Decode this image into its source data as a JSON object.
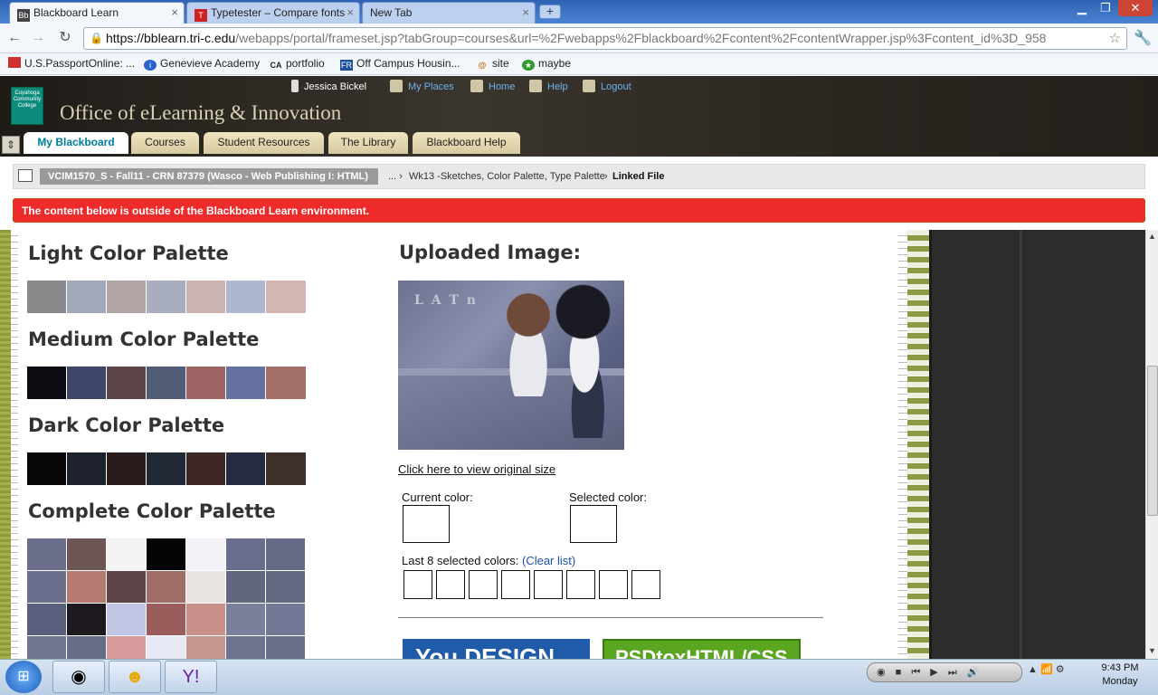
{
  "browser": {
    "tabs": [
      {
        "label": "Blackboard Learn",
        "icon": "Bb"
      },
      {
        "label": "Typetester – Compare fonts",
        "icon": "T"
      },
      {
        "label": "New Tab",
        "icon": ""
      }
    ],
    "new_tab": "+",
    "url_host": "https://bblearn.tri-c.edu",
    "url_path": "/webapps/portal/frameset.jsp?tabGroup=courses&url=%2Fwebapps%2Fblackboard%2Fcontent%2FcontentWrapper.jsp%3Fcontent_id%3D_958",
    "bookmarks": [
      "U.S.PassportOnline: ...",
      "Genevieve Academy",
      "portfolio",
      "Off Campus Housin...",
      "site",
      "maybe"
    ]
  },
  "blackboard": {
    "logo_text": "Cuyahoga Community College",
    "site_title": "Office of eLearning & Innovation",
    "user_name": "Jessica Bickel",
    "utility_links": [
      "My Places",
      "Home",
      "Help",
      "Logout"
    ],
    "tabs": [
      "My Blackboard",
      "Courses",
      "Student Resources",
      "The Library",
      "Blackboard Help"
    ],
    "course_name": "VCIM1570_S - Fall11 - CRN 87379 (Wasco - Web Publishing I: HTML)",
    "breadcrumb_ellipsis": "...",
    "breadcrumb_item": "Wk13 -Sketches, Color Palette, Type Palette",
    "breadcrumb_current": "Linked File",
    "separator": "›",
    "alert": "The content below is outside of the Blackboard Learn environment."
  },
  "palettes": {
    "light_title": "Light Color Palette",
    "light": [
      "#8a8a8c",
      "#a2a7b9",
      "#b3a4a4",
      "#a8aebd",
      "#cdb2b2",
      "#afb6cf",
      "#d3b5b2"
    ],
    "medium_title": "Medium Color Palette",
    "medium": [
      "#0c0c12",
      "#3c4666",
      "#5f4448",
      "#515c77",
      "#9c6462",
      "#65729f",
      "#a46e6a"
    ],
    "dark_title": "Dark Color Palette",
    "dark": [
      "#060608",
      "#1d222e",
      "#2a1c1d",
      "#222936",
      "#3d2727",
      "#252b40",
      "#40302c"
    ],
    "complete_title": "Complete Color Palette",
    "complete": [
      "#6a6e8a",
      "#6e5654",
      "#f3f3f3",
      "#050508",
      "#f2f2f6",
      "#696e8e",
      "#656a86",
      "#6b6f8d",
      "#b57a70",
      "#5d4548",
      "#a06c68",
      "#e8e2e1",
      "#62677f",
      "#646983",
      "#5a5f7d",
      "#1f1a1f",
      "#c3c5e4",
      "#9b5d5b",
      "#c99089",
      "#7a7f9b",
      "#737896",
      "#70758f",
      "#676c88",
      "#d99b9b",
      "#e7e9f4",
      "#c4968e",
      "#6e7390",
      "#6a6f8b"
    ]
  },
  "uploader": {
    "title": "Uploaded Image:",
    "image_overlay": "L A T n",
    "view_link": "Click here to view original size",
    "current_label": "Current color:",
    "selected_label": "Selected color:",
    "last_label": "Last 8 selected colors:",
    "clear_label": "(Clear list)",
    "ad_left": "You DESIGN",
    "ad_right": "PSDtoxHTML/CSS"
  },
  "taskbar": {
    "time": "9:43 PM",
    "day": "Monday"
  }
}
